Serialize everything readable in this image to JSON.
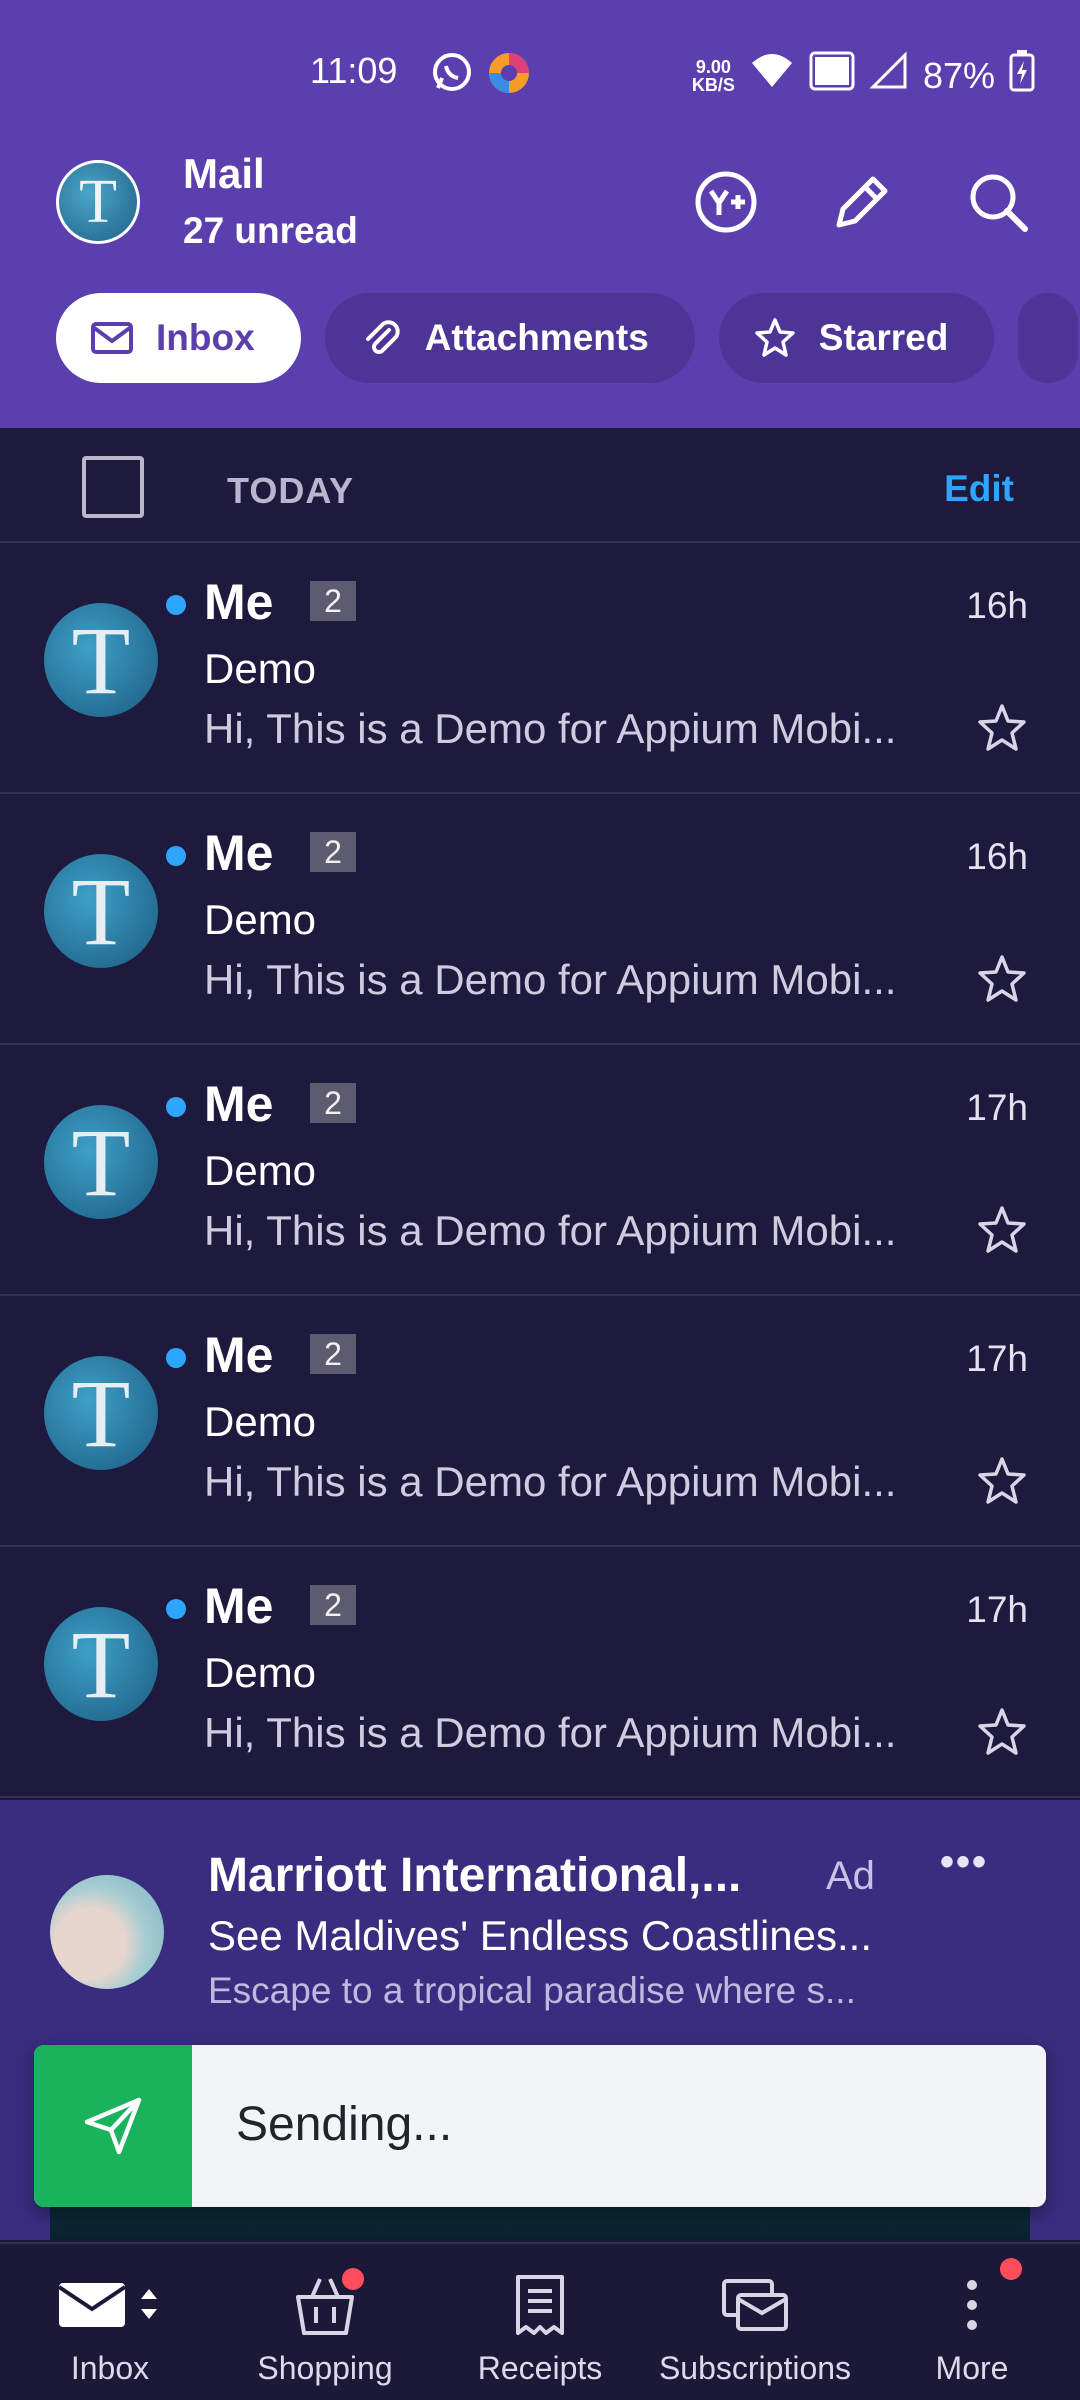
{
  "status_bar": {
    "time": "11:09",
    "speed_value": "9.00",
    "speed_unit": "KB/S",
    "battery": "87%"
  },
  "header": {
    "title": "Mail",
    "subtitle": "27 unread",
    "avatar_letter": "T",
    "actions": [
      "yplus-icon",
      "compose-icon",
      "search-icon"
    ]
  },
  "chips": [
    {
      "label": "Inbox",
      "icon": "envelope-icon",
      "active": true
    },
    {
      "label": "Attachments",
      "icon": "paperclip-icon",
      "active": false
    },
    {
      "label": "Starred",
      "icon": "star-icon",
      "active": false
    }
  ],
  "section": {
    "label": "TODAY",
    "edit": "Edit"
  },
  "messages": [
    {
      "sender": "Me",
      "count": "2",
      "time": "16h",
      "subject": "Demo",
      "preview": "Hi, This is a Demo for Appium Mobi...",
      "avatar": "T"
    },
    {
      "sender": "Me",
      "count": "2",
      "time": "16h",
      "subject": "Demo",
      "preview": "Hi, This is a Demo for Appium Mobi...",
      "avatar": "T"
    },
    {
      "sender": "Me",
      "count": "2",
      "time": "17h",
      "subject": "Demo",
      "preview": "Hi, This is a Demo for Appium Mobi...",
      "avatar": "T"
    },
    {
      "sender": "Me",
      "count": "2",
      "time": "17h",
      "subject": "Demo",
      "preview": "Hi, This is a Demo for Appium Mobi...",
      "avatar": "T"
    },
    {
      "sender": "Me",
      "count": "2",
      "time": "17h",
      "subject": "Demo",
      "preview": "Hi, This is a Demo for Appium Mobi...",
      "avatar": "T"
    }
  ],
  "ad": {
    "title": "Marriott International,...",
    "label": "Ad",
    "more": "•••",
    "subtitle": "See Maldives' Endless Coastlines...",
    "body": "Escape to a tropical paradise where s..."
  },
  "toast": {
    "text": "Sending..."
  },
  "bottom_nav": [
    {
      "label": "Inbox",
      "icon": "inbox-icon",
      "badge": false
    },
    {
      "label": "Shopping",
      "icon": "shopping-bag-icon",
      "badge": true
    },
    {
      "label": "Receipts",
      "icon": "receipt-icon",
      "badge": false
    },
    {
      "label": "Subscriptions",
      "icon": "subscriptions-icon",
      "badge": false
    },
    {
      "label": "More",
      "icon": "more-vertical-icon",
      "badge": true
    }
  ],
  "colors": {
    "header_bg": "#5b3fae",
    "list_bg": "#1d1a3e",
    "accent_blue": "#2ea6ff",
    "toast_green": "#1ab35c",
    "badge_red": "#ff4d5b"
  }
}
